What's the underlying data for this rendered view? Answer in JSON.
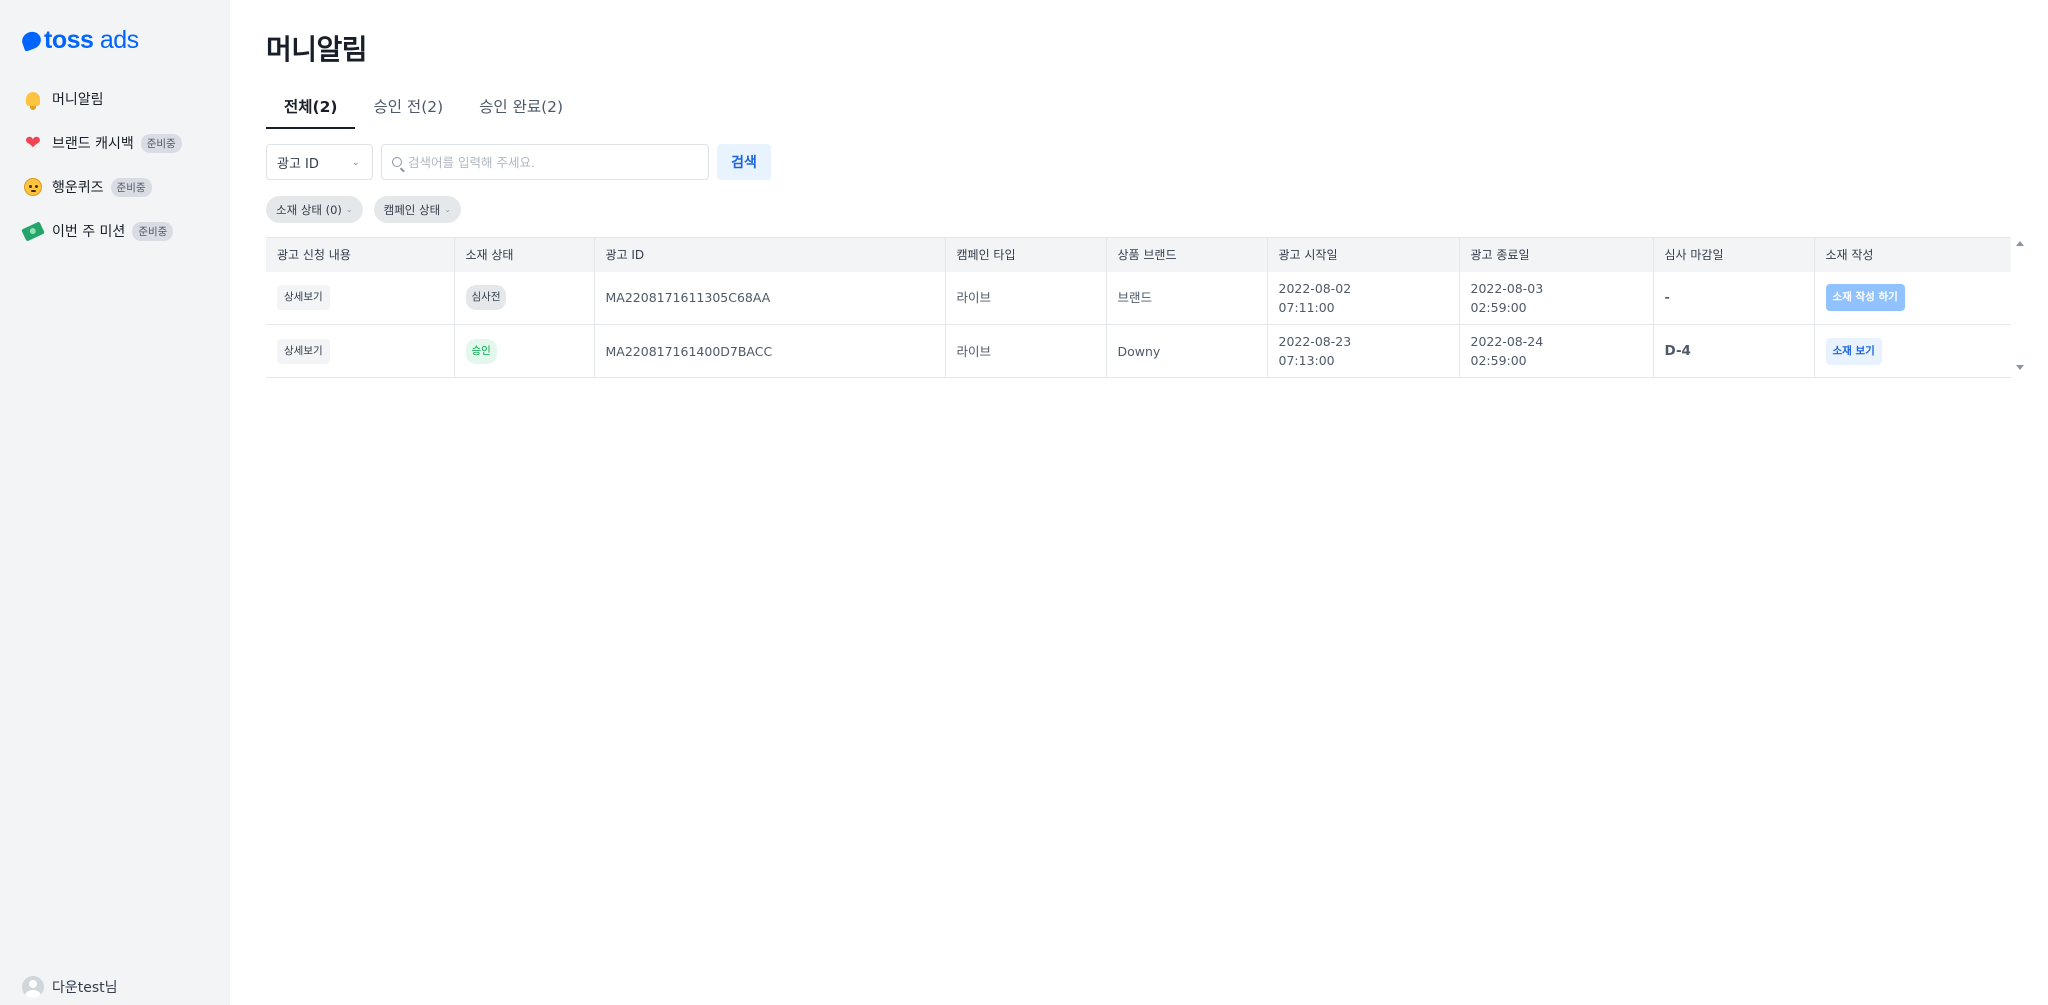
{
  "sidebar": {
    "logo": {
      "brand": "toss",
      "suffix": "ads"
    },
    "items": [
      {
        "label": "머니알림",
        "icon": "bell-icon",
        "badge": ""
      },
      {
        "label": "브랜드 캐시백",
        "icon": "heart-icon",
        "badge": "준비중"
      },
      {
        "label": "행운퀴즈",
        "icon": "smile-face-icon",
        "badge": "준비중"
      },
      {
        "label": "이번 주 미션",
        "icon": "money-icon",
        "badge": "준비중"
      }
    ],
    "user": {
      "name": "다운test님"
    }
  },
  "page": {
    "title": "머니알림"
  },
  "tabs": [
    {
      "label": "전체(2)",
      "active": true
    },
    {
      "label": "승인 전(2)",
      "active": false
    },
    {
      "label": "승인 완료(2)",
      "active": false
    }
  ],
  "search": {
    "field_select": "광고 ID",
    "placeholder": "검색어를 입력해 주세요.",
    "value": "",
    "button": "검색"
  },
  "filters": [
    {
      "label": "소재 상태 (0)"
    },
    {
      "label": "캠페인 상태"
    }
  ],
  "table": {
    "headers": [
      "광고 신청 내용",
      "소재 상태",
      "광고 ID",
      "캠페인 타입",
      "상품 브랜드",
      "광고 시작일",
      "광고 종료일",
      "심사 마감일",
      "소재 작성"
    ],
    "rows": [
      {
        "detail": "상세보기",
        "status": "심사전",
        "ad_id": "MA2208171611305C68AA",
        "campaign_type": "라이브",
        "brand": "브랜드",
        "start_date": "2022-08-02",
        "start_time": "07:11:00",
        "end_date": "2022-08-03",
        "end_time": "02:59:00",
        "deadline": "-",
        "action": "소재 작성 하기"
      },
      {
        "detail": "상세보기",
        "status": "승인",
        "ad_id": "MA220817161400D7BACC",
        "campaign_type": "라이브",
        "brand": "Downy",
        "start_date": "2022-08-23",
        "start_time": "07:13:00",
        "end_date": "2022-08-24",
        "end_time": "02:59:00",
        "deadline": "D-4",
        "action": "소재 보기"
      }
    ]
  },
  "colors": {
    "brand": "#0064ff",
    "sidebar_bg": "#f2f4f6",
    "approved": "#03a94d",
    "primary_light": "#e8f3ff"
  }
}
